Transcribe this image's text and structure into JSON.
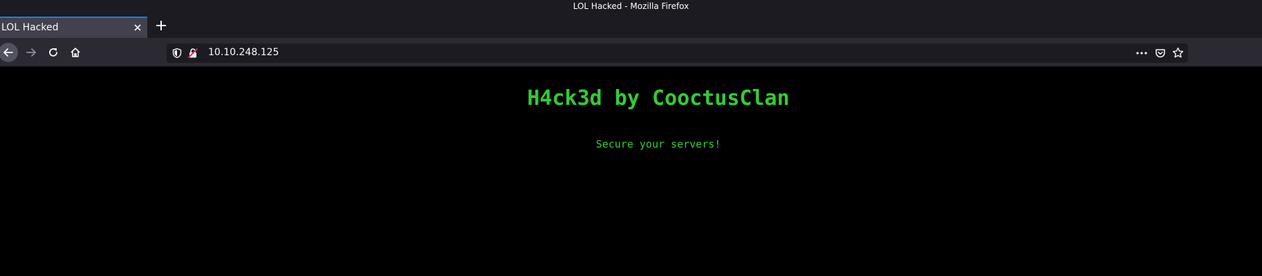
{
  "window": {
    "title": "LOL Hacked - Mozilla Firefox"
  },
  "tabs": [
    {
      "title": "LOL Hacked"
    }
  ],
  "urlbar": {
    "url": "10.10.248.125"
  },
  "page": {
    "heading": "H4ck3d by CooctusClan",
    "message": "Secure your servers!"
  },
  "icons": {
    "back": "arrow-left-icon",
    "forward": "arrow-right-icon",
    "reload": "reload-icon",
    "home": "home-icon",
    "tracking": "shield-icon",
    "insecure": "insecure-lock-icon",
    "menu": "more-horizontal-icon",
    "pocket": "pocket-icon",
    "bookmark": "star-icon",
    "close_tab": "close-icon",
    "new_tab": "plus-icon"
  },
  "colors": {
    "accent": "#0a84ff",
    "hack_green": "#33cc33",
    "toolbar": "#2b2a33",
    "chrome": "#1c1b22"
  }
}
